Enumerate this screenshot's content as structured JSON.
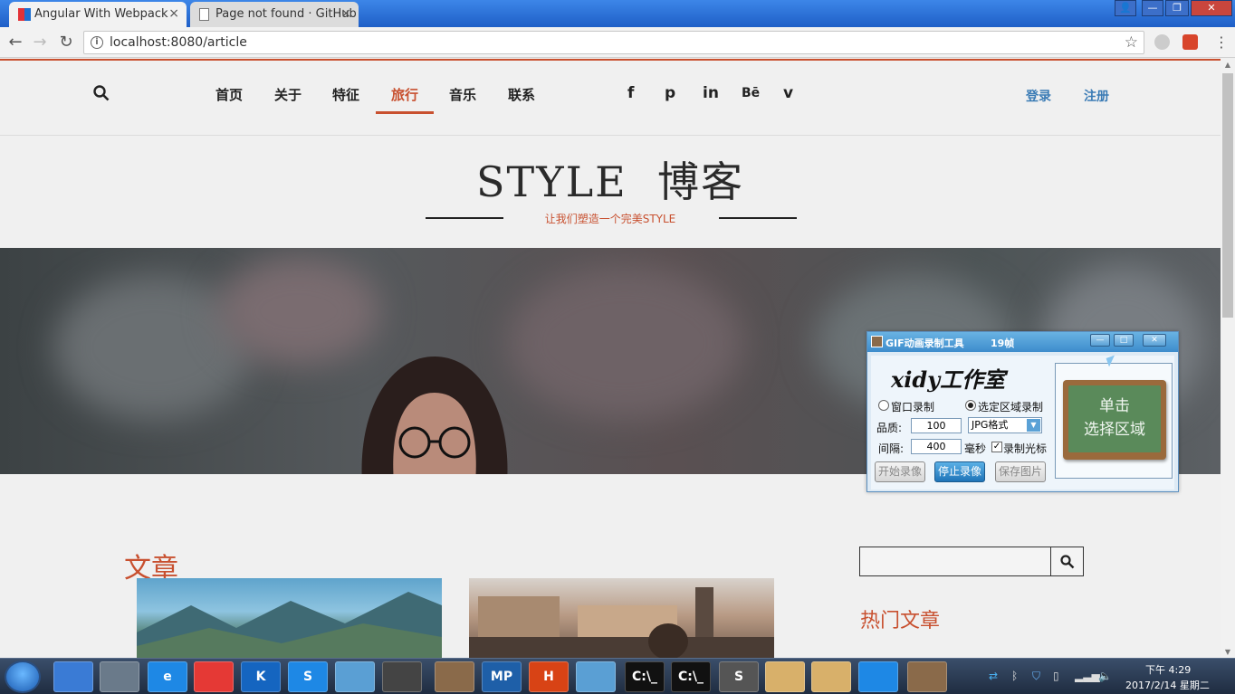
{
  "browser": {
    "tabs": [
      {
        "title": "Angular With Webpack",
        "close": "×"
      },
      {
        "title": "Page not found · GitHub",
        "close": "×"
      }
    ],
    "window_controls": [
      "—",
      "❐",
      "✕"
    ],
    "nav": {
      "back": "←",
      "forward": "→",
      "reload": "↻"
    },
    "address": "localhost:8080/article",
    "info_glyph": "i",
    "star": "☆"
  },
  "site": {
    "nav_items": [
      "首页",
      "关于",
      "特征",
      "旅行",
      "音乐",
      "联系"
    ],
    "active_nav": "旅行",
    "social": [
      "f",
      "p",
      "in",
      "Bē",
      "v"
    ],
    "login": "登录",
    "register": "注册",
    "brand": "STYLE  博客",
    "tagline": "让我们塑造一个完美STYLE",
    "section_title": "文章",
    "hot_title": "热门文章",
    "accent_color": "#c8502f",
    "link_color": "#3a7bb5"
  },
  "gif_tool": {
    "title": "GIF动画录制工具",
    "frames": "19帧",
    "controls": [
      "—",
      "□",
      "✕"
    ],
    "studio": "xidy工作室",
    "mode_window": "窗口录制",
    "mode_region": "选定区域录制",
    "quality_label": "品质:",
    "quality_value": "100",
    "format": "JPG格式",
    "interval_label": "间隔:",
    "interval_value": "400",
    "interval_unit": "毫秒",
    "record_cursor": "录制光标",
    "btn_start": "开始录像",
    "btn_stop": "停止录像",
    "btn_save": "保存图片",
    "board_line1": "单击",
    "board_line2": "选择区域"
  },
  "taskbar": {
    "apps": [
      "",
      "",
      "e",
      "",
      "K",
      "S",
      "",
      "",
      "",
      "MP",
      "H",
      "",
      "C:\\_",
      "C:\\_",
      "S",
      "",
      "",
      "",
      ""
    ],
    "time": "下午 4:29",
    "date": "2017/2/14 星期二"
  }
}
